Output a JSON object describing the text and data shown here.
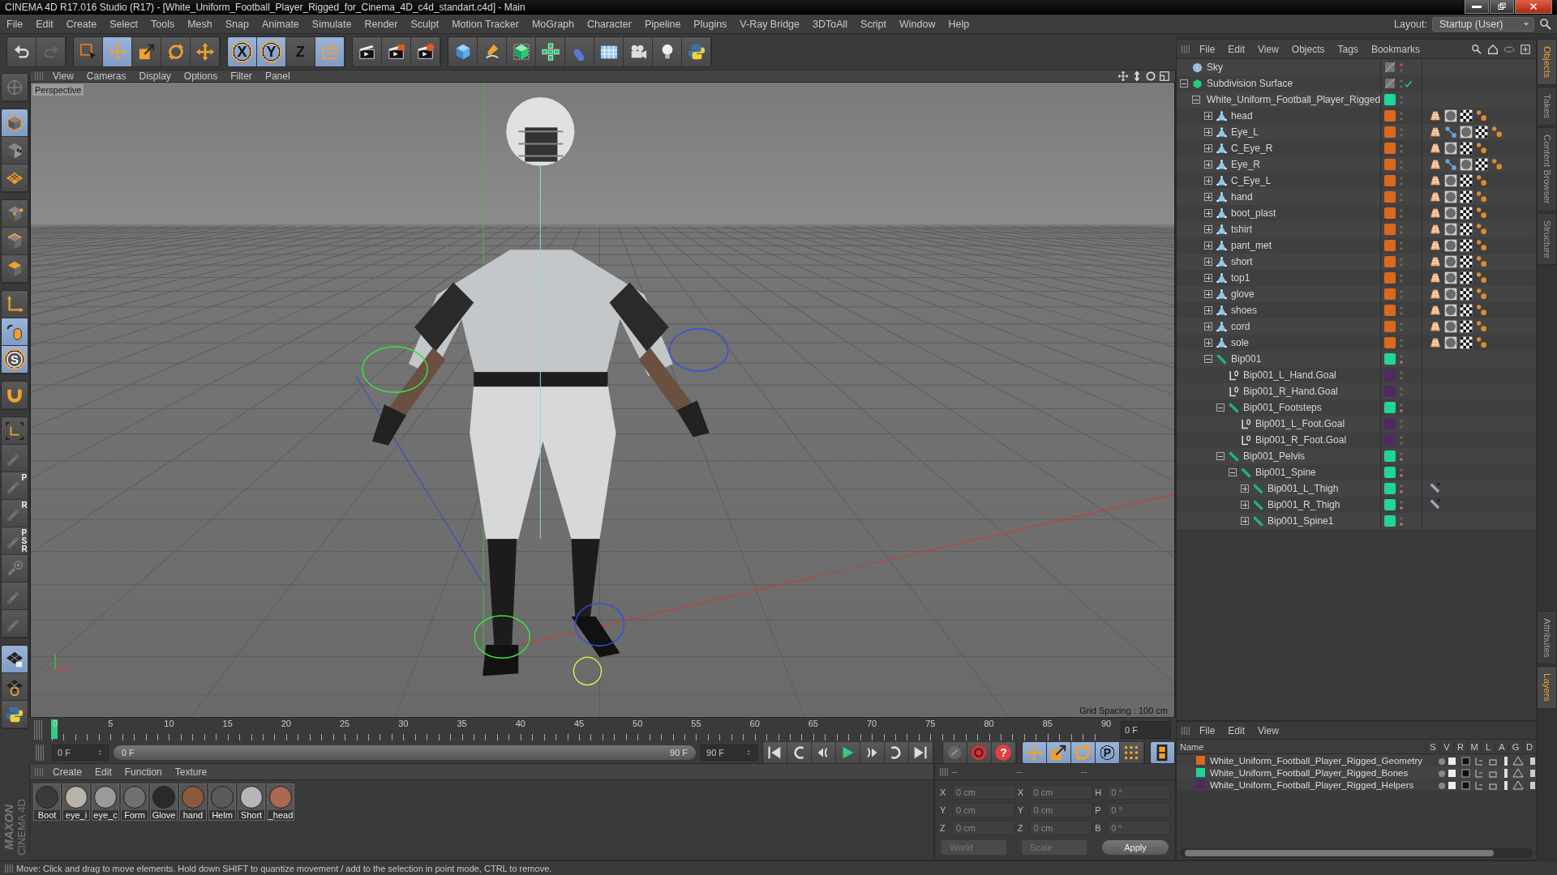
{
  "window": {
    "title": "CINEMA 4D R17.016 Studio (R17) - [White_Uniform_Football_Player_Rigged_for_Cinema_4D_c4d_standart.c4d] - Main"
  },
  "menu": [
    "File",
    "Edit",
    "Create",
    "Select",
    "Tools",
    "Mesh",
    "Snap",
    "Animate",
    "Simulate",
    "Render",
    "Sculpt",
    "Motion Tracker",
    "MoGraph",
    "Character",
    "Pipeline",
    "Plugins",
    "V-Ray Bridge",
    "3DToAll",
    "Script",
    "Window",
    "Help"
  ],
  "layout": {
    "label": "Layout:",
    "value": "Startup (User)"
  },
  "toolbar": [
    [
      {
        "kind": "undo",
        "selected": false
      },
      {
        "kind": "redo",
        "selected": false
      }
    ],
    [
      {
        "kind": "select",
        "selected": false
      },
      {
        "kind": "move",
        "selected": true
      },
      {
        "kind": "scale",
        "selected": false
      },
      {
        "kind": "rotate",
        "selected": false
      },
      {
        "kind": "add",
        "selected": false
      }
    ],
    [
      {
        "kind": "axis",
        "label": "X",
        "selected": true
      },
      {
        "kind": "axis",
        "label": "Y",
        "selected": true
      },
      {
        "kind": "axis",
        "label": "Z",
        "selected": false
      },
      {
        "kind": "world",
        "selected": true
      }
    ],
    [
      {
        "kind": "render-view",
        "selected": false
      },
      {
        "kind": "render",
        "selected": false
      },
      {
        "kind": "render-settings",
        "selected": false
      }
    ],
    [
      {
        "kind": "cube",
        "selected": false
      },
      {
        "kind": "pen",
        "selected": false
      },
      {
        "kind": "subdivision",
        "selected": false
      },
      {
        "kind": "cloner",
        "selected": false
      },
      {
        "kind": "deformer",
        "selected": false
      },
      {
        "kind": "floor",
        "selected": false
      },
      {
        "kind": "camera",
        "selected": false
      },
      {
        "kind": "light",
        "selected": false
      },
      {
        "kind": "python",
        "selected": false
      }
    ]
  ],
  "side_tools": [
    [
      {
        "kind": "solo",
        "selected": false
      }
    ],
    [
      {
        "kind": "model",
        "selected": true
      },
      {
        "kind": "texture",
        "selected": false
      },
      {
        "kind": "workplane",
        "selected": false
      }
    ],
    [
      {
        "kind": "points",
        "selected": false
      },
      {
        "kind": "edges",
        "selected": false
      },
      {
        "kind": "polygons",
        "selected": false
      }
    ],
    [
      {
        "kind": "axis",
        "selected": false
      },
      {
        "kind": "tweak",
        "selected": true
      },
      {
        "kind": "snap",
        "label": "S",
        "selected": true
      }
    ],
    [
      {
        "kind": "magnet",
        "selected": false
      }
    ],
    [
      {
        "kind": "axis-lock",
        "selected": false
      },
      {
        "kind": "joint",
        "selected": false
      },
      {
        "kind": "joint",
        "label": "P",
        "selected": false
      },
      {
        "kind": "joint",
        "label": "R",
        "selected": false
      },
      {
        "kind": "joint",
        "label": "PSR",
        "selected": false
      },
      {
        "kind": "joint-target",
        "selected": false
      },
      {
        "kind": "joint",
        "selected": false
      },
      {
        "kind": "joint",
        "selected": false
      }
    ],
    [
      {
        "kind": "grid-lock",
        "selected": true
      },
      {
        "kind": "grid-rotate",
        "selected": false
      },
      {
        "kind": "python",
        "selected": false
      }
    ]
  ],
  "logo": {
    "brand": "MAXON",
    "product": "CINEMA 4D"
  },
  "viewport": {
    "menu": [
      "View",
      "Cameras",
      "Display",
      "Options",
      "Filter",
      "Panel"
    ],
    "camera": "Perspective",
    "grid_spacing": "Grid Spacing : 100 cm"
  },
  "timeline": {
    "ticks": [
      "0",
      "5",
      "10",
      "15",
      "20",
      "25",
      "30",
      "35",
      "40",
      "45",
      "50",
      "55",
      "60",
      "65",
      "70",
      "75",
      "80",
      "85",
      "90"
    ],
    "playhead": {
      "level": 0
    },
    "current_field": "0 F"
  },
  "frame_controls": {
    "start_field": "0 F",
    "range": {
      "start": "0 F",
      "end": "90 F",
      "level": 1
    },
    "end_field": "90 F",
    "buttons": [
      [
        {
          "kind": "first",
          "selected": false
        },
        {
          "kind": "prev-key",
          "selected": false
        },
        {
          "kind": "prev-frame",
          "selected": false
        },
        {
          "kind": "play",
          "selected": false
        },
        {
          "kind": "next-frame",
          "selected": false
        },
        {
          "kind": "next-key",
          "selected": false
        },
        {
          "kind": "last",
          "selected": false
        }
      ],
      [
        {
          "kind": "autokey",
          "selected": false
        },
        {
          "kind": "record",
          "selected": false
        },
        {
          "kind": "help",
          "label": "?",
          "selected": false
        }
      ],
      [
        {
          "kind": "key-move",
          "selected": true
        },
        {
          "kind": "key-scale",
          "selected": true
        },
        {
          "kind": "key-rotate",
          "selected": true
        },
        {
          "kind": "key-param",
          "label": "P",
          "selected": true
        },
        {
          "kind": "key-points",
          "selected": false
        }
      ],
      [
        {
          "kind": "timeline",
          "selected": true
        }
      ]
    ]
  },
  "materials": {
    "menu": [
      "Create",
      "Edit",
      "Function",
      "Texture"
    ],
    "items": [
      {
        "name": "Boot",
        "color": "#3a3a3a"
      },
      {
        "name": "eye_i",
        "color": "#b9b2a8"
      },
      {
        "name": "eye_c",
        "color": "#9a9a9a"
      },
      {
        "name": "Form",
        "color": "#707070"
      },
      {
        "name": "Glove",
        "color": "#2a2a2a"
      },
      {
        "name": "hand",
        "color": "#8a5a3c"
      },
      {
        "name": "Helm",
        "color": "#5a5a5a"
      },
      {
        "name": "Short",
        "color": "#b4b6b8"
      },
      {
        "name": "_head",
        "color": "#a86a50"
      }
    ]
  },
  "coordinates": {
    "headers": [
      "--",
      "--",
      "--"
    ],
    "rows": [
      [
        {
          "axis": "X",
          "value": "0 cm"
        },
        {
          "axis": "X",
          "value": "0 cm"
        },
        {
          "axis": "H",
          "value": "0 °"
        }
      ],
      [
        {
          "axis": "Y",
          "value": "0 cm"
        },
        {
          "axis": "Y",
          "value": "0 cm"
        },
        {
          "axis": "P",
          "value": "0 °"
        }
      ],
      [
        {
          "axis": "Z",
          "value": "0 cm"
        },
        {
          "axis": "Z",
          "value": "0 cm"
        },
        {
          "axis": "B",
          "value": "0 °"
        }
      ]
    ],
    "dropdowns": [
      "World",
      "Scale"
    ],
    "apply": "Apply"
  },
  "objects": {
    "menu": [
      "File",
      "Edit",
      "View",
      "Objects",
      "Tags",
      "Bookmarks"
    ],
    "items": [
      {
        "name": "Sky",
        "kind": "sky"
      },
      {
        "name": "Subdivision Surface",
        "kind": "subdivision",
        "expanded": true,
        "check": true,
        "children": [
          {
            "name": "White_Uniform_Football_Player_Rigged",
            "kind": "null",
            "color": "#1fd69a",
            "expanded": true,
            "children": [
              {
                "name": "head",
                "kind": "polygon",
                "color": "#d86a20",
                "expanded": false,
                "tags": [
                  {
                    "kind": "phong"
                  },
                  {
                    "kind": "material"
                  },
                  {
                    "kind": "checker"
                  },
                  {
                    "kind": "selection"
                  }
                ]
              },
              {
                "name": "Eye_L",
                "kind": "polygon",
                "color": "#d86a20",
                "expanded": false,
                "tags": [
                  {
                    "kind": "phong"
                  },
                  {
                    "kind": "weights"
                  },
                  {
                    "kind": "material"
                  },
                  {
                    "kind": "checker"
                  },
                  {
                    "kind": "selection"
                  }
                ]
              },
              {
                "name": "C_Eye_R",
                "kind": "polygon",
                "color": "#d86a20",
                "expanded": false,
                "tags": [
                  {
                    "kind": "phong"
                  },
                  {
                    "kind": "material"
                  },
                  {
                    "kind": "checker"
                  },
                  {
                    "kind": "selection"
                  }
                ]
              },
              {
                "name": "Eye_R",
                "kind": "polygon",
                "color": "#d86a20",
                "expanded": false,
                "tags": [
                  {
                    "kind": "phong"
                  },
                  {
                    "kind": "weights"
                  },
                  {
                    "kind": "material"
                  },
                  {
                    "kind": "checker"
                  },
                  {
                    "kind": "selection"
                  }
                ]
              },
              {
                "name": "C_Eye_L",
                "kind": "polygon",
                "color": "#d86a20",
                "expanded": false,
                "tags": [
                  {
                    "kind": "phong"
                  },
                  {
                    "kind": "material"
                  },
                  {
                    "kind": "checker"
                  },
                  {
                    "kind": "selection"
                  }
                ]
              },
              {
                "name": "hand",
                "kind": "polygon",
                "color": "#d86a20",
                "expanded": false,
                "tags": [
                  {
                    "kind": "phong"
                  },
                  {
                    "kind": "material"
                  },
                  {
                    "kind": "checker"
                  },
                  {
                    "kind": "selection"
                  }
                ]
              },
              {
                "name": "boot_plast",
                "kind": "polygon",
                "color": "#d86a20",
                "expanded": false,
                "tags": [
                  {
                    "kind": "phong"
                  },
                  {
                    "kind": "material"
                  },
                  {
                    "kind": "checker"
                  },
                  {
                    "kind": "selection"
                  }
                ]
              },
              {
                "name": "tshirt",
                "kind": "polygon",
                "color": "#d86a20",
                "expanded": false,
                "tags": [
                  {
                    "kind": "phong"
                  },
                  {
                    "kind": "material"
                  },
                  {
                    "kind": "checker"
                  },
                  {
                    "kind": "selection"
                  }
                ]
              },
              {
                "name": "pant_met",
                "kind": "polygon",
                "color": "#d86a20",
                "expanded": false,
                "tags": [
                  {
                    "kind": "phong"
                  },
                  {
                    "kind": "material"
                  },
                  {
                    "kind": "checker"
                  },
                  {
                    "kind": "selection"
                  }
                ]
              },
              {
                "name": "short",
                "kind": "polygon",
                "color": "#d86a20",
                "expanded": false,
                "tags": [
                  {
                    "kind": "phong"
                  },
                  {
                    "kind": "material"
                  },
                  {
                    "kind": "checker"
                  },
                  {
                    "kind": "selection"
                  }
                ]
              },
              {
                "name": "top1",
                "kind": "polygon",
                "color": "#d86a20",
                "expanded": false,
                "tags": [
                  {
                    "kind": "phong"
                  },
                  {
                    "kind": "material"
                  },
                  {
                    "kind": "checker"
                  },
                  {
                    "kind": "selection"
                  }
                ]
              },
              {
                "name": "glove",
                "kind": "polygon",
                "color": "#d86a20",
                "expanded": false,
                "tags": [
                  {
                    "kind": "phong"
                  },
                  {
                    "kind": "material"
                  },
                  {
                    "kind": "checker"
                  },
                  {
                    "kind": "selection"
                  }
                ]
              },
              {
                "name": "shoes",
                "kind": "polygon",
                "color": "#d86a20",
                "expanded": false,
                "tags": [
                  {
                    "kind": "phong"
                  },
                  {
                    "kind": "material"
                  },
                  {
                    "kind": "checker"
                  },
                  {
                    "kind": "selection"
                  }
                ]
              },
              {
                "name": "cord",
                "kind": "polygon",
                "color": "#d86a20",
                "expanded": false,
                "tags": [
                  {
                    "kind": "phong"
                  },
                  {
                    "kind": "material"
                  },
                  {
                    "kind": "checker"
                  },
                  {
                    "kind": "selection"
                  }
                ]
              },
              {
                "name": "sole",
                "kind": "polygon",
                "color": "#d86a20",
                "expanded": false,
                "tags": [
                  {
                    "kind": "phong"
                  },
                  {
                    "kind": "material"
                  },
                  {
                    "kind": "checker"
                  },
                  {
                    "kind": "selection"
                  }
                ]
              },
              {
                "name": "Bip001",
                "kind": "bone",
                "color": "#1fd69a",
                "expanded": true,
                "children": [
                  {
                    "name": "Bip001_L_Hand.Goal",
                    "kind": "null",
                    "color": "#4e2a5e"
                  },
                  {
                    "name": "Bip001_R_Hand.Goal",
                    "kind": "null",
                    "color": "#4e2a5e"
                  },
                  {
                    "name": "Bip001_Footsteps",
                    "kind": "bone",
                    "color": "#1fd69a",
                    "expanded": true,
                    "children": [
                      {
                        "name": "Bip001_L_Foot.Goal",
                        "kind": "null",
                        "color": "#4e2a5e"
                      },
                      {
                        "name": "Bip001_R_Foot.Goal",
                        "kind": "null",
                        "color": "#4e2a5e"
                      }
                    ]
                  },
                  {
                    "name": "Bip001_Pelvis",
                    "kind": "bone",
                    "color": "#1fd69a",
                    "expanded": true,
                    "children": [
                      {
                        "name": "Bip001_Spine",
                        "kind": "bone",
                        "color": "#1fd69a",
                        "expanded": true,
                        "children": [
                          {
                            "name": "Bip001_L_Thigh",
                            "kind": "bone",
                            "color": "#1fd69a",
                            "expanded": false,
                            "tags": [
                              {
                                "kind": "ik"
                              }
                            ]
                          },
                          {
                            "name": "Bip001_R_Thigh",
                            "kind": "bone",
                            "color": "#1fd69a",
                            "expanded": false,
                            "tags": [
                              {
                                "kind": "ik"
                              }
                            ]
                          },
                          {
                            "name": "Bip001_Spine1",
                            "kind": "bone",
                            "color": "#1fd69a",
                            "expanded": false
                          }
                        ]
                      }
                    ]
                  }
                ]
              }
            ]
          }
        ]
      }
    ]
  },
  "side_tabs": {
    "top": [
      {
        "label": "Objects",
        "selected": true
      },
      {
        "label": "Takes",
        "selected": false
      },
      {
        "label": "Content Browser",
        "selected": false
      },
      {
        "label": "Structure",
        "selected": false
      }
    ],
    "bottom": [
      {
        "label": "Attributes",
        "selected": false
      },
      {
        "label": "Layers",
        "selected": true
      }
    ]
  },
  "layers": {
    "menu": [
      "File",
      "Edit",
      "View"
    ],
    "columns": [
      "Name",
      "S",
      "V",
      "R",
      "M",
      "L",
      "A",
      "G",
      "D"
    ],
    "rows": [
      {
        "name": "White_Uniform_Football_Player_Rigged_Geometry",
        "color": "#d86a20"
      },
      {
        "name": "White_Uniform_Football_Player_Rigged_Bones",
        "color": "#1fd69a"
      },
      {
        "name": "White_Uniform_Football_Player_Rigged_Helpers",
        "color": "#4e2a5e"
      }
    ]
  },
  "status_bar": "Move: Click and drag to move elements. Hold down SHIFT to quantize movement / add to the selection in point mode, CTRL to remove."
}
